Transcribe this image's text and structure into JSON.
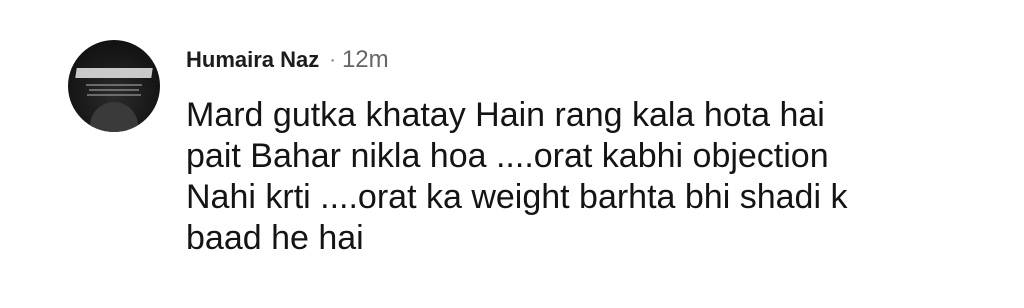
{
  "comment": {
    "author": "Humaira Naz",
    "separator": "·",
    "time": "12m",
    "text_lines": [
      "Mard gutka khatay Hain rang kala hota hai",
      "pait Bahar nikla hoa ....orat kabhi objection",
      "Nahi krti ....orat ka weight barhta bhi shadi k",
      "baad he hai"
    ]
  }
}
